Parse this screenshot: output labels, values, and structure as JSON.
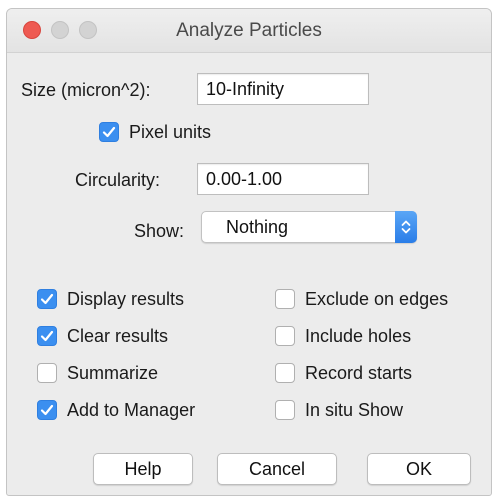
{
  "window": {
    "title": "Analyze Particles"
  },
  "form": {
    "size_label": "Size (micron^2):",
    "size_value": "10-Infinity",
    "pixel_units_label": "Pixel units",
    "pixel_units_checked": true,
    "circularity_label": "Circularity:",
    "circularity_value": "0.00-1.00",
    "show_label": "Show:",
    "show_value": "Nothing"
  },
  "options": [
    {
      "label": "Display results",
      "checked": true
    },
    {
      "label": "Clear results",
      "checked": true
    },
    {
      "label": "Summarize",
      "checked": false
    },
    {
      "label": "Add to Manager",
      "checked": true
    },
    {
      "label": "Exclude on edges",
      "checked": false
    },
    {
      "label": "Include holes",
      "checked": false
    },
    {
      "label": "Record starts",
      "checked": false
    },
    {
      "label": "In situ Show",
      "checked": false
    }
  ],
  "buttons": {
    "help": "Help",
    "cancel": "Cancel",
    "ok": "OK"
  },
  "colors": {
    "accent": "#3b8ff0",
    "close": "#ee5a52",
    "window_bg": "#ececec"
  }
}
